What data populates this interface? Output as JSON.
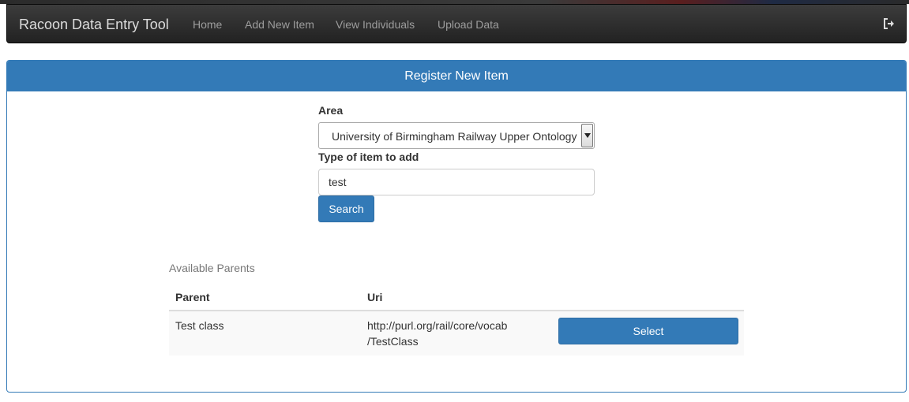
{
  "navbar": {
    "brand": "Racoon Data Entry Tool",
    "links": [
      "Home",
      "Add New Item",
      "View Individuals",
      "Upload Data"
    ],
    "logout_icon": "sign-out-icon"
  },
  "panel": {
    "title": "Register New Item"
  },
  "form": {
    "area_label": "Area",
    "area_selected": "University of Birmingham Railway Upper Ontology",
    "type_label": "Type of item to add",
    "type_value": "test",
    "search_label": "Search"
  },
  "parents": {
    "caption": "Available Parents",
    "columns": [
      "Parent",
      "Uri"
    ],
    "rows": [
      {
        "parent": "Test class",
        "uri_line1": "http://purl.org/rail/core/vocab",
        "uri_line2": "/TestClass",
        "action": "Select"
      }
    ]
  },
  "colors": {
    "primary": "#337ab7",
    "navbar": "#222222"
  }
}
